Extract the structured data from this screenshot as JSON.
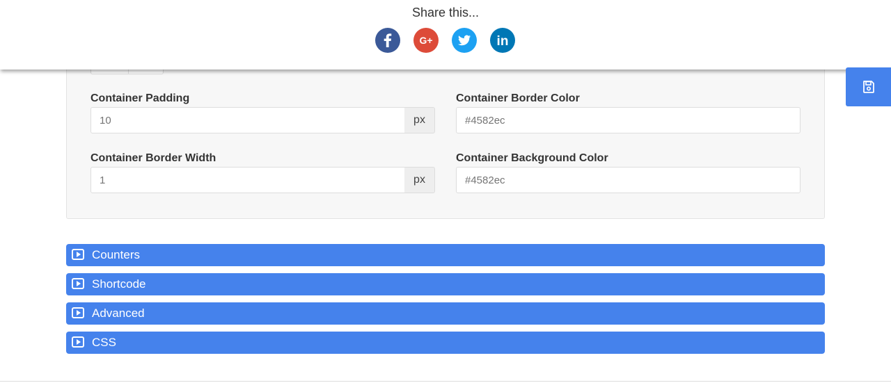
{
  "share": {
    "title": "Share this...",
    "icons": [
      {
        "name": "facebook-icon",
        "color": "#3b5998"
      },
      {
        "name": "google-plus-icon",
        "color": "#dd4b39",
        "glyph": "G+"
      },
      {
        "name": "twitter-icon",
        "color": "#1da1f2"
      },
      {
        "name": "linkedin-icon",
        "color": "#0077b5",
        "glyph": "in"
      }
    ]
  },
  "form": {
    "container_padding": {
      "label": "Container Padding",
      "placeholder": "10",
      "unit": "px"
    },
    "container_border_width": {
      "label": "Container Border Width",
      "placeholder": "1",
      "unit": "px"
    },
    "container_border_color": {
      "label": "Container Border Color",
      "placeholder": "#4582ec"
    },
    "container_background_color": {
      "label": "Container Background Color",
      "placeholder": "#4582ec"
    }
  },
  "save": {
    "icon": "save-icon",
    "color": "#4582ec"
  },
  "accordion": [
    {
      "label": "Counters"
    },
    {
      "label": "Shortcode"
    },
    {
      "label": "Advanced"
    },
    {
      "label": "CSS"
    }
  ],
  "colors": {
    "accent": "#4582ec"
  }
}
